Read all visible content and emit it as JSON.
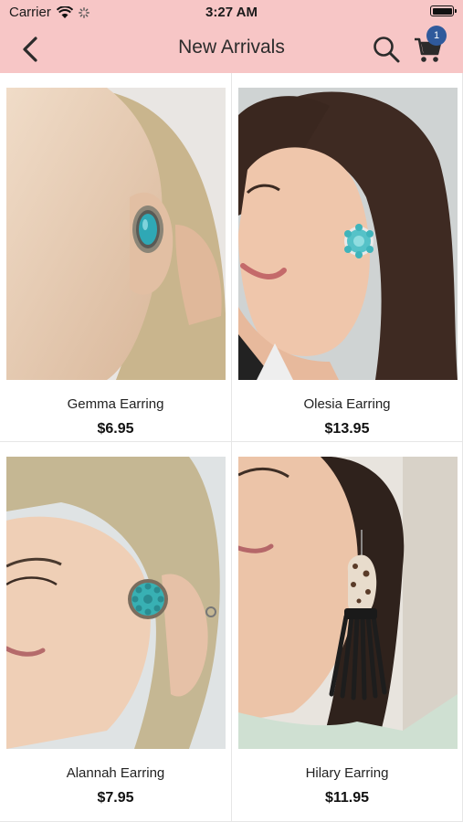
{
  "status_bar": {
    "carrier": "Carrier",
    "time": "3:27 AM",
    "wifi_icon": "wifi-icon",
    "activity_icon": "activity-spinner-icon",
    "battery_icon": "battery-icon"
  },
  "nav": {
    "title": "New Arrivals",
    "back_icon": "chevron-left-icon",
    "search_icon": "search-icon",
    "cart_icon": "cart-icon",
    "cart_count": "1",
    "background": "#f7c6c6",
    "badge_color": "#2f5a9c"
  },
  "products": [
    {
      "name": "Gemma Earring",
      "price": "$6.95"
    },
    {
      "name": "Olesia Earring",
      "price": "$13.95"
    },
    {
      "name": "Alannah Earring",
      "price": "$7.95"
    },
    {
      "name": "Hilary Earring",
      "price": "$11.95"
    }
  ]
}
